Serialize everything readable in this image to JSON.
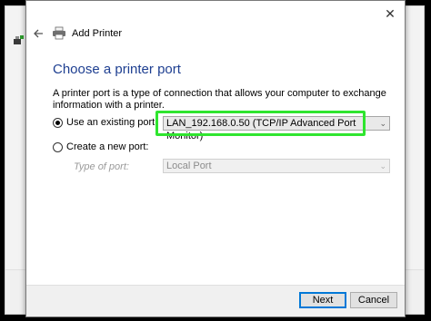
{
  "dialog": {
    "title": "Add Printer",
    "close_glyph": "✕",
    "back_icon": "back-arrow-icon",
    "printer_icon": "printer-icon"
  },
  "page": {
    "heading": "Choose a printer port",
    "description": "A printer port is a type of connection that allows your computer to exchange information with a printer."
  },
  "existing_port": {
    "label": "Use an existing port:",
    "selected": true,
    "value": "LAN_192.168.0.50 (TCP/IP Advanced Port Monitor)"
  },
  "new_port": {
    "label": "Create a new port:",
    "selected": false,
    "type_label": "Type of port:",
    "type_value": "Local Port"
  },
  "buttons": {
    "next": "Next",
    "cancel": "Cancel"
  },
  "colors": {
    "heading": "#1e3f91",
    "highlight": "#2fe52f",
    "default_button_border": "#0078d7"
  }
}
